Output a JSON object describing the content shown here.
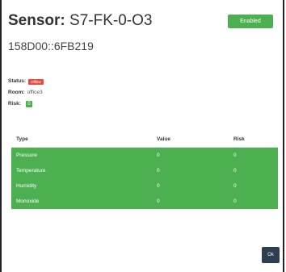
{
  "header": {
    "title_label": "Sensor:",
    "title_value": "S7-FK-0-O3",
    "enabled_badge": "Enabled",
    "subtitle": "158D00::6FB219"
  },
  "info": {
    "status_label": "Status:",
    "status_value": "Offline",
    "room_label": "Room:",
    "room_value": "office3",
    "risk_label": "Risk:",
    "risk_value": "0"
  },
  "table": {
    "headers": [
      "Type",
      "Value",
      "Risk"
    ],
    "rows": [
      {
        "type": "Pressure",
        "value": "0",
        "risk": "0"
      },
      {
        "type": "Temperature",
        "value": "0",
        "risk": "0"
      },
      {
        "type": "Humidity",
        "value": "0",
        "risk": "0"
      },
      {
        "type": "Monoxide",
        "value": "0",
        "risk": "0"
      }
    ]
  },
  "footer": {
    "ok_label": "Ok"
  },
  "colors": {
    "success": "#4cb050",
    "danger": "#e74c3c",
    "dark_button": "#2c3e50"
  }
}
